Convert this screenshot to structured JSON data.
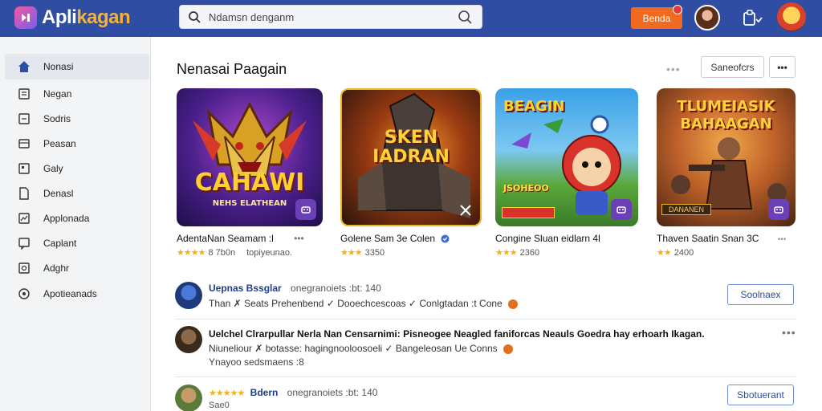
{
  "header": {
    "logo_text_main": "Apli",
    "logo_text_accent": "kagan",
    "logo_title": "Aplikagan",
    "search_value": "Ndamsn denganm",
    "action_button": "Benda",
    "colors": {
      "bar": "#2f4ea3",
      "action": "#f06a20"
    }
  },
  "sidebar": {
    "items": [
      {
        "label": "Nonasi",
        "icon": "home-icon"
      },
      {
        "label": "Negan",
        "icon": "document-icon"
      },
      {
        "label": "Sodris",
        "icon": "list-icon"
      },
      {
        "label": "Peasan",
        "icon": "panel-icon"
      },
      {
        "label": "Galy",
        "icon": "gallery-icon"
      },
      {
        "label": "Denasl",
        "icon": "file-icon"
      },
      {
        "label": "Applonada",
        "icon": "chart-icon"
      },
      {
        "label": "Caplant",
        "icon": "chat-icon"
      },
      {
        "label": "Adghr",
        "icon": "settings-icon"
      },
      {
        "label": "Apotieanads",
        "icon": "apps-icon"
      }
    ]
  },
  "main": {
    "title": "Nenasai Paagain",
    "faint_dots": "•••",
    "sort_button": "Saneofcrs",
    "more_button": "•••",
    "cards": [
      {
        "art_title": "CAHAWI",
        "art_sub": "NEHS ELATHEAN",
        "name": "AdentaNan Seamam :l",
        "rating_stars": "★★★★",
        "rating": "8 7b0n",
        "extra": "topiyeunao.",
        "menu": "•••"
      },
      {
        "art_title": "SKEN IADRAN",
        "art_sub": "",
        "name": "Golene Sam 3e Colen",
        "rating_stars": "★★★",
        "rating": "3350",
        "extra": "",
        "menu": ""
      },
      {
        "art_title": "BEAGIN",
        "art_sub": "JSOHEOO",
        "name": "Congine Sluan eidlarn 4l",
        "rating_stars": "★★★",
        "rating": "2360",
        "extra": "",
        "menu": ""
      },
      {
        "art_title": "TLUMEIASIK BAHAAGAN",
        "art_sub": "DANANEN",
        "name": "Thaven Saatin Snan 3C",
        "rating_stars": "★★",
        "rating": "2400",
        "extra": "",
        "menu": "•••"
      }
    ],
    "rows": [
      {
        "title": "Uepnas Bssglar",
        "meta": "onegranoiets :bt: 140",
        "sub": "Than ✗ Seats Prehenbend ✓ Dooechcescoas ✓ Conlgtadan :t Cone",
        "button": "Soolnaex"
      },
      {
        "title": "Uelchel Clrarpullar Nerla Nan Censarnimi: Pisneogee Neagled faniforcas Neauls Goedra hay erhoarh Ikagan.",
        "sub": "Niuneliour ✗ botasse: hagingnooloosoeli ✓ Bangeleosan Ue Conns",
        "sub2": "Ynayoo sedsmaens :8",
        "menu": "•••"
      },
      {
        "stars": "★★★★★",
        "title": "Bdern",
        "meta": "onegranoiets :bt: 140",
        "sub": "Sae0",
        "button": "Sbotuerant"
      }
    ]
  }
}
